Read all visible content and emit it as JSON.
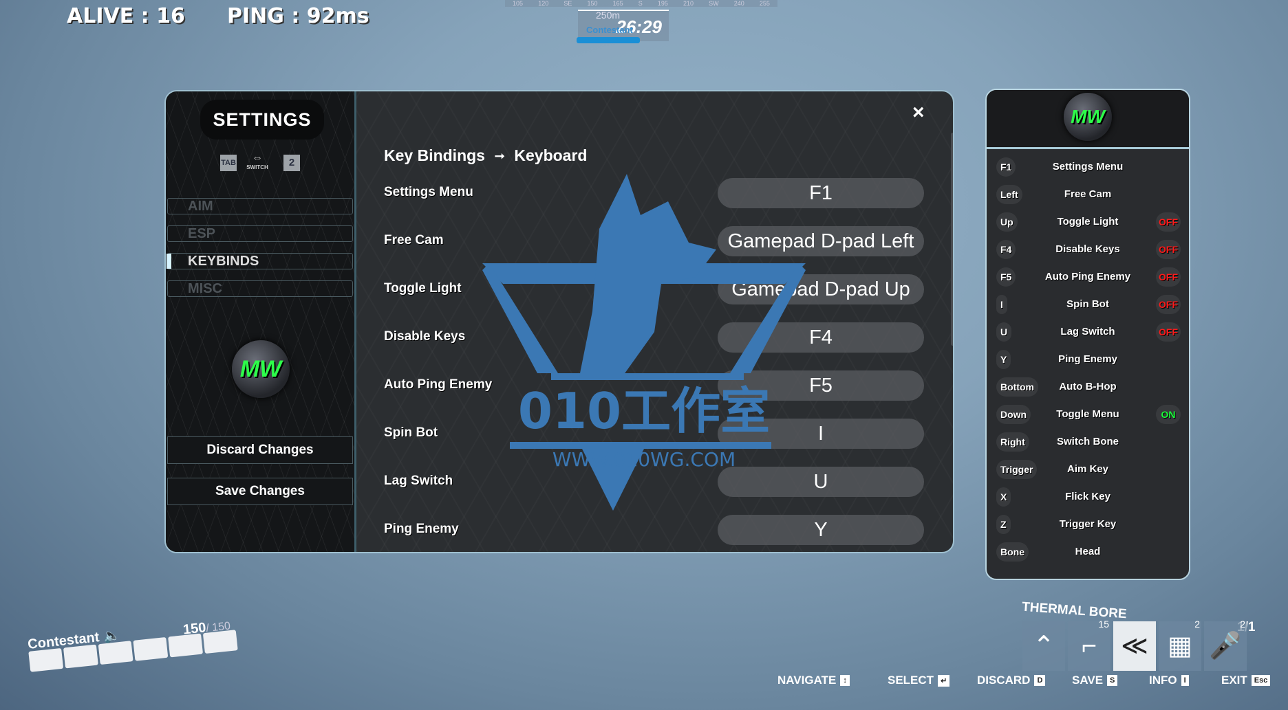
{
  "hud": {
    "alive": "ALIVE : 16",
    "ping": "PING : 92ms",
    "compass_ticks": [
      "105",
      "120",
      "SE",
      "150",
      "165",
      "S",
      "195",
      "210",
      "SW",
      "240",
      "255"
    ],
    "distance": "250m",
    "timer": "26:29",
    "player_tag": "Contestant"
  },
  "sidebar": {
    "title": "SETTINGS",
    "tab_key": "TAB",
    "switch_label": "SWITCH",
    "switch_icon": "double-arrow-icon",
    "page_key": "2",
    "items": [
      {
        "label": "AIM",
        "active": false
      },
      {
        "label": "ESP",
        "active": false
      },
      {
        "label": "KEYBINDS",
        "active": true
      },
      {
        "label": "MISC",
        "active": false
      }
    ],
    "logo_text": "MW",
    "discard": "Discard Changes",
    "save": "Save Changes"
  },
  "main": {
    "breadcrumb": [
      "Key Bindings",
      "Keyboard"
    ],
    "breadcrumb_sep": "⭢",
    "close": "×",
    "bindings": [
      {
        "label": "Settings Menu",
        "key": "F1"
      },
      {
        "label": "Free Cam",
        "key": "Gamepad D-pad Left"
      },
      {
        "label": "Toggle Light",
        "key": "Gamepad D-pad Up"
      },
      {
        "label": "Disable Keys",
        "key": "F4"
      },
      {
        "label": "Auto Ping Enemy",
        "key": "F5"
      },
      {
        "label": "Spin Bot",
        "key": "I"
      },
      {
        "label": "Lag Switch",
        "key": "U"
      },
      {
        "label": "Ping Enemy",
        "key": "Y"
      }
    ]
  },
  "watermark": {
    "text": "010工作室",
    "url": "WWW.010WG.COM",
    "color": "#3b78b4"
  },
  "overlay": {
    "logo_text": "MW",
    "rows": [
      {
        "key": "F1",
        "name": "Settings Menu",
        "status": ""
      },
      {
        "key": "Left",
        "name": "Free Cam",
        "status": ""
      },
      {
        "key": "Up",
        "name": "Toggle Light",
        "status": "OFF"
      },
      {
        "key": "F4",
        "name": "Disable Keys",
        "status": "OFF"
      },
      {
        "key": "F5",
        "name": "Auto Ping Enemy",
        "status": "OFF"
      },
      {
        "key": "I",
        "name": "Spin Bot",
        "status": "OFF"
      },
      {
        "key": "U",
        "name": "Lag Switch",
        "status": "OFF"
      },
      {
        "key": "Y",
        "name": "Ping Enemy",
        "status": ""
      },
      {
        "key": "Bottom",
        "name": "Auto B-Hop",
        "status": ""
      },
      {
        "key": "Down",
        "name": "Toggle Menu",
        "status": "ON"
      },
      {
        "key": "Right",
        "name": "Switch Bone",
        "status": ""
      },
      {
        "key": "Trigger",
        "name": "Aim Key",
        "status": ""
      },
      {
        "key": "X",
        "name": "Flick Key",
        "status": ""
      },
      {
        "key": "Z",
        "name": "Trigger Key",
        "status": ""
      },
      {
        "key": "Bone",
        "name": "Head",
        "status": ""
      }
    ],
    "colors": {
      "off": "#ff1a1a",
      "on": "#1aff3a"
    }
  },
  "player": {
    "name": "Contestant",
    "health": "150",
    "health_max": "/ 150",
    "armor_segments": 6
  },
  "weapon": {
    "name": "THERMAL BORE",
    "slot_counts": [
      "",
      "15",
      "",
      "2",
      "2"
    ],
    "ammo": "1/1"
  },
  "footer": [
    {
      "label": "NAVIGATE",
      "key": "↕"
    },
    {
      "label": "SELECT",
      "key": "↵"
    },
    {
      "label": "DISCARD",
      "key": "D"
    },
    {
      "label": "SAVE",
      "key": "S"
    },
    {
      "label": "INFO",
      "key": "I"
    },
    {
      "label": "EXIT",
      "key": "Esc"
    }
  ]
}
